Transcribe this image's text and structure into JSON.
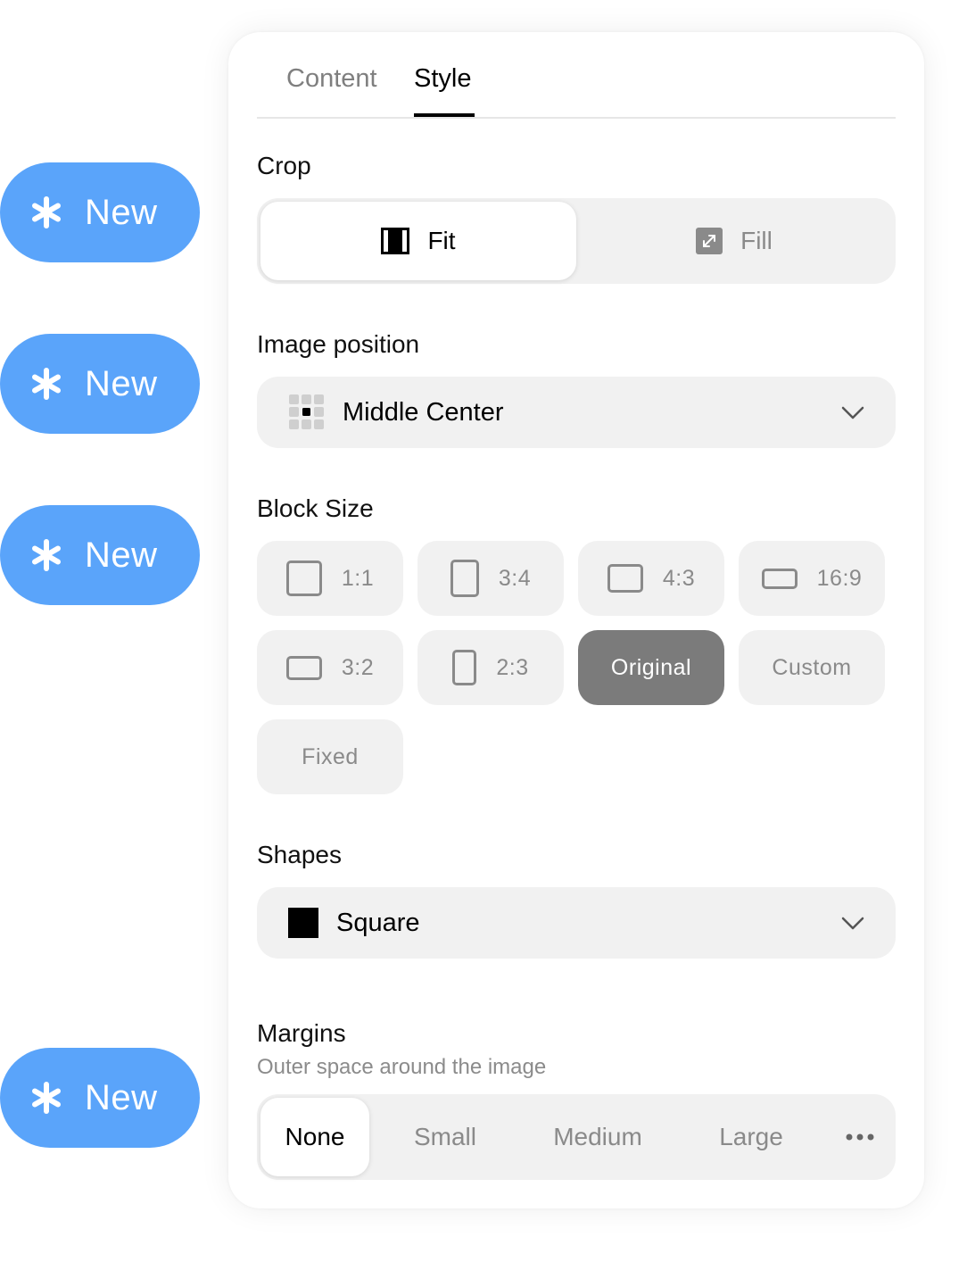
{
  "badges": [
    {
      "label": "New"
    },
    {
      "label": "New"
    },
    {
      "label": "New"
    },
    {
      "label": "New"
    }
  ],
  "tabs": {
    "content": "Content",
    "style": "Style",
    "active": "Style"
  },
  "crop": {
    "label": "Crop",
    "options": [
      "Fit",
      "Fill"
    ],
    "selected": "Fit"
  },
  "image_position": {
    "label": "Image position",
    "value": "Middle Center"
  },
  "block_size": {
    "label": "Block Size",
    "options": [
      "1:1",
      "3:4",
      "4:3",
      "16:9",
      "3:2",
      "2:3",
      "Original",
      "Custom",
      "Fixed"
    ],
    "selected": "Original"
  },
  "shapes": {
    "label": "Shapes",
    "value": "Square"
  },
  "margins": {
    "label": "Margins",
    "description": "Outer space around the image",
    "options": [
      "None",
      "Small",
      "Medium",
      "Large"
    ],
    "selected": "None"
  },
  "colors": {
    "badge": "#5aa4fa",
    "selected_block": "#7b7b7b",
    "control_bg": "#f1f1f1",
    "muted_text": "#8a8a8a"
  },
  "icons": {
    "badge": "asterisk-icon",
    "fit": "fit-frame-icon",
    "fill": "expand-icon",
    "position": "grid-dot-icon",
    "dropdown": "chevron-down-icon",
    "shape": "square-icon",
    "more": "more-horizontal-icon"
  }
}
